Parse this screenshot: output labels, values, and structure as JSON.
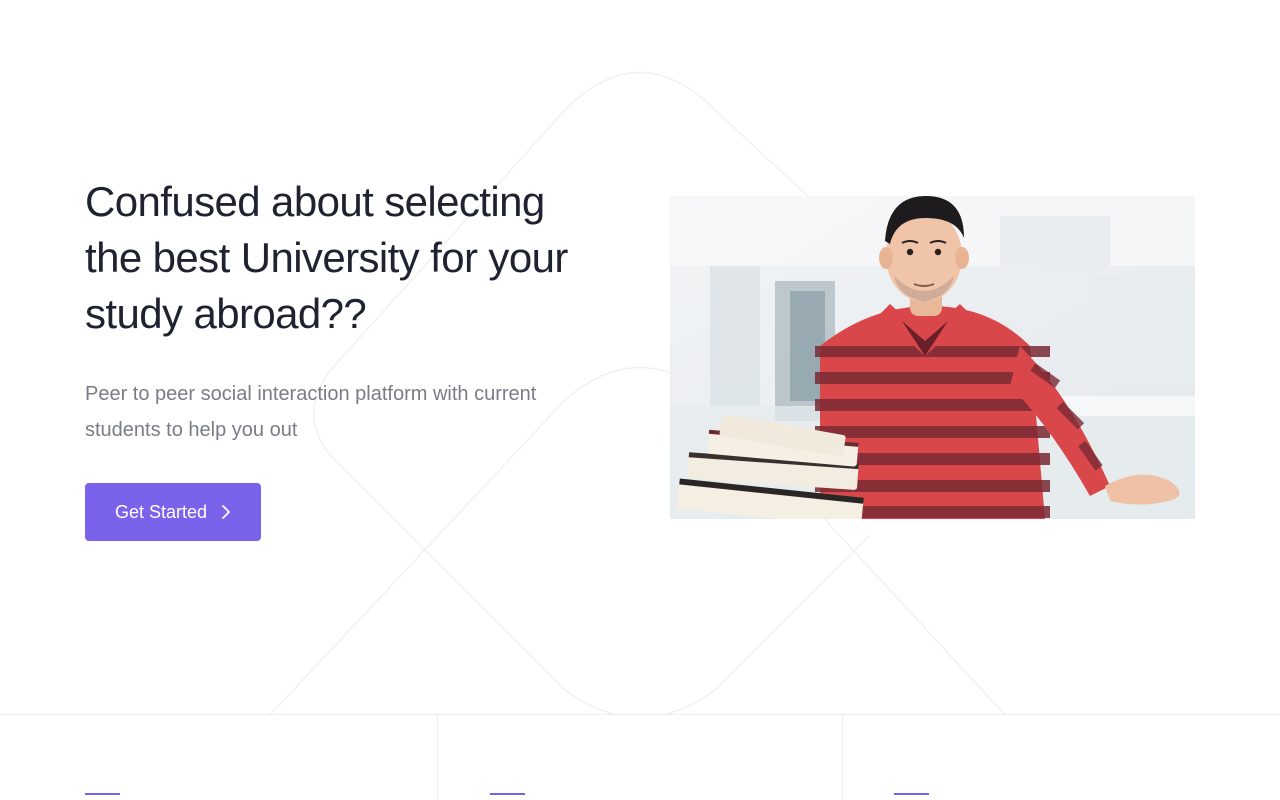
{
  "hero": {
    "headline": "Confused about selecting the best University for your study abroad??",
    "subtext": "Peer to peer social interaction platform with current students to help you out",
    "cta_label": "Get Started",
    "cta_icon": "chevron-right-icon",
    "image": "student-with-books-shrugging"
  },
  "colors": {
    "accent": "#7b62ea",
    "headline": "#1f2230",
    "subtext": "#7a7d86",
    "divider": "#ececf0"
  },
  "features": [
    {
      "accent": "short-purple-line"
    },
    {
      "accent": "short-purple-line"
    },
    {
      "accent": "short-purple-line"
    }
  ]
}
